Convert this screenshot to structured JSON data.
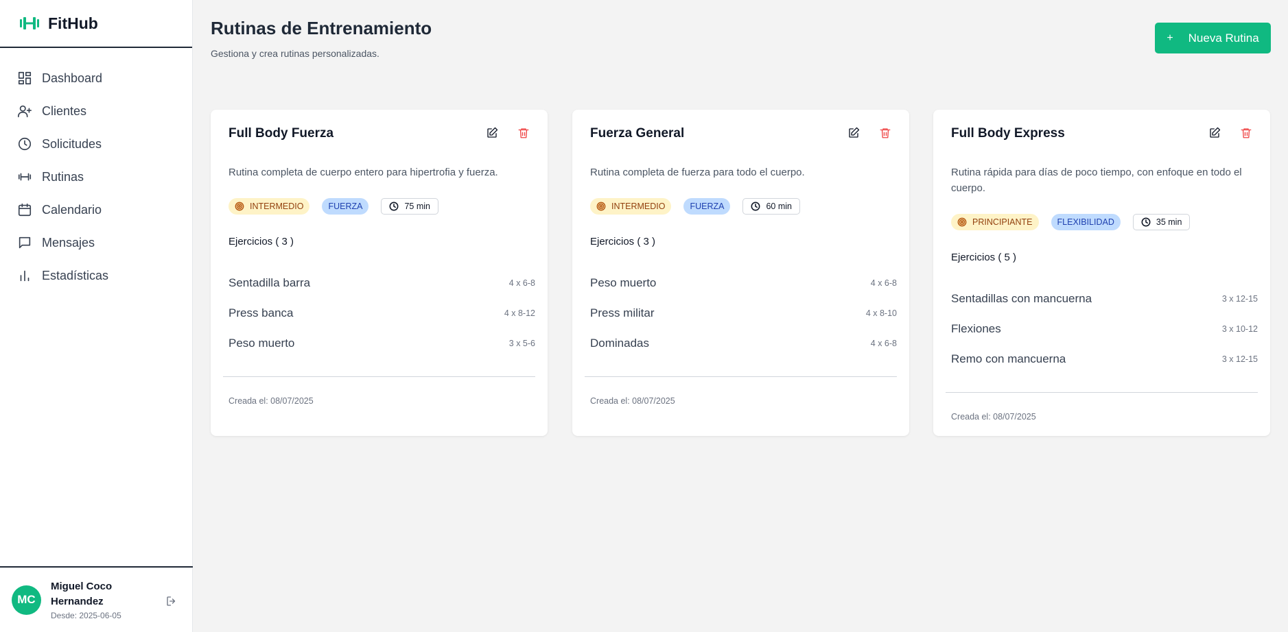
{
  "app": {
    "name": "FitHub"
  },
  "sidebar": {
    "items": [
      {
        "label": "Dashboard",
        "icon": "dashboard-icon"
      },
      {
        "label": "Clientes",
        "icon": "user-plus-icon"
      },
      {
        "label": "Solicitudes",
        "icon": "clock-icon"
      },
      {
        "label": "Rutinas",
        "icon": "dumbbell-icon"
      },
      {
        "label": "Calendario",
        "icon": "calendar-icon"
      },
      {
        "label": "Mensajes",
        "icon": "message-icon"
      },
      {
        "label": "Estadísticas",
        "icon": "bar-chart-icon"
      }
    ]
  },
  "user": {
    "initials": "MC",
    "name": "Miguel Coco Hernandez",
    "since": "Desde: 2025-06-05"
  },
  "header": {
    "title": "Rutinas de Entrenamiento",
    "subtitle": "Gestiona y crea rutinas personalizadas.",
    "new_button": "Nueva Rutina",
    "new_button_icon": "+"
  },
  "colors": {
    "accent": "#10b981",
    "danger": "#ef4444"
  },
  "routines": [
    {
      "title": "Full Body Fuerza",
      "description": "Rutina completa de cuerpo entero para hipertrofia y fuerza.",
      "level": "INTERMEDIO",
      "type": "FUERZA",
      "duration": "75 min",
      "exercises_label": "Ejercicios ( 3 )",
      "exercises": [
        {
          "name": "Sentadilla barra",
          "sets": "4 x 6-8"
        },
        {
          "name": "Press banca",
          "sets": "4 x 8-12"
        },
        {
          "name": "Peso muerto",
          "sets": "3 x 5-6"
        }
      ],
      "created": "Creada el: 08/07/2025"
    },
    {
      "title": "Fuerza General",
      "description": "Rutina completa de fuerza para todo el cuerpo.",
      "level": "INTERMEDIO",
      "type": "FUERZA",
      "duration": "60 min",
      "exercises_label": "Ejercicios ( 3 )",
      "exercises": [
        {
          "name": "Peso muerto",
          "sets": "4 x 6-8"
        },
        {
          "name": "Press militar",
          "sets": "4 x 8-10"
        },
        {
          "name": "Dominadas",
          "sets": "4 x 6-8"
        }
      ],
      "created": "Creada el: 08/07/2025"
    },
    {
      "title": "Full Body Express",
      "description": "Rutina rápida para días de poco tiempo, con enfoque en todo el cuerpo.",
      "level": "PRINCIPIANTE",
      "type": "FLEXIBILIDAD",
      "duration": "35 min",
      "exercises_label": "Ejercicios ( 5 )",
      "exercises": [
        {
          "name": "Sentadillas con mancuerna",
          "sets": "3 x 12-15"
        },
        {
          "name": "Flexiones",
          "sets": "3 x 10-12"
        },
        {
          "name": "Remo con mancuerna",
          "sets": "3 x 12-15"
        }
      ],
      "created": "Creada el: 08/07/2025"
    }
  ]
}
